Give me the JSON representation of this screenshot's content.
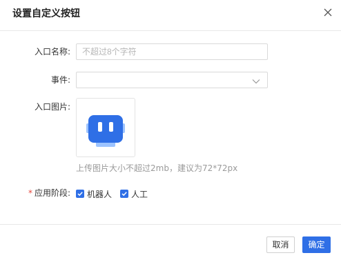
{
  "dialog": {
    "title": "设置自定义按钮",
    "close_icon": "close-icon"
  },
  "form": {
    "entry_name": {
      "label": "入口名称:",
      "value": "",
      "placeholder": "不超过8个字符"
    },
    "event": {
      "label": "事件:",
      "value": "",
      "icon": "chevron-down-icon"
    },
    "entry_image": {
      "label": "入口图片:",
      "image_icon": "robot-icon",
      "hint": "上传图片大小不超过2mb，建议为72*72px"
    },
    "stage": {
      "required_mark": "*",
      "label": "应用阶段:",
      "options": [
        {
          "label": "机器人",
          "checked": true
        },
        {
          "label": "人工",
          "checked": true
        }
      ]
    }
  },
  "footer": {
    "cancel_label": "取消",
    "confirm_label": "确定"
  },
  "colors": {
    "accent": "#2f6fe6",
    "required": "#e5453a",
    "hint": "#9a9a9a"
  }
}
